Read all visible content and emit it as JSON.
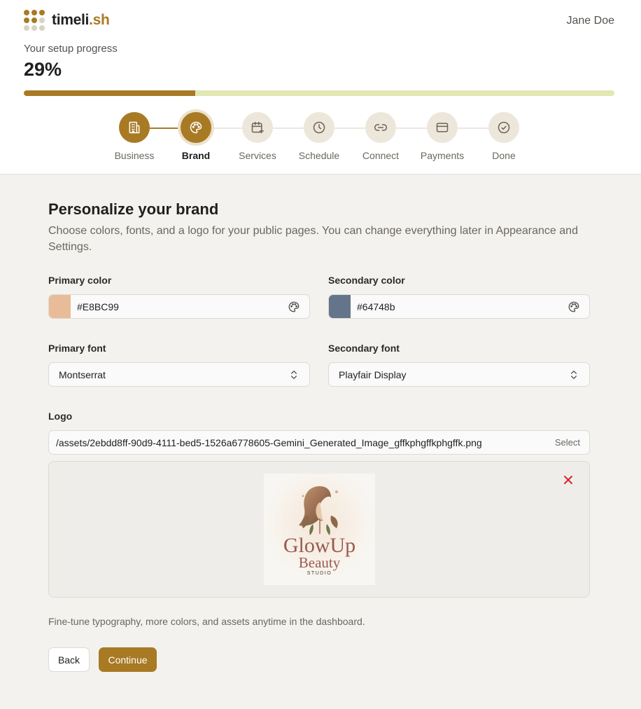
{
  "app": {
    "logo_text": "timeli",
    "logo_accent": ".sh",
    "user_name": "Jane Doe",
    "brand_color": "#a87a24"
  },
  "progress": {
    "label": "Your setup progress",
    "value_text": "29%",
    "fraction": 0.29
  },
  "steps": [
    {
      "label": "Business",
      "status": "done",
      "icon": "building-icon"
    },
    {
      "label": "Brand",
      "status": "current",
      "icon": "palette-icon"
    },
    {
      "label": "Services",
      "status": "pending",
      "icon": "calendar-plus-icon"
    },
    {
      "label": "Schedule",
      "status": "pending",
      "icon": "clock-icon"
    },
    {
      "label": "Connect",
      "status": "pending",
      "icon": "link-icon"
    },
    {
      "label": "Payments",
      "status": "pending",
      "icon": "credit-card-icon"
    },
    {
      "label": "Done",
      "status": "pending",
      "icon": "check-circle-icon"
    }
  ],
  "page": {
    "title": "Personalize your brand",
    "subtitle": "Choose colors, fonts, and a logo for your public pages. You can change everything later in Appearance and Settings."
  },
  "form": {
    "primary_color": {
      "label": "Primary color",
      "value": "#E8BC99",
      "swatch": "#E8BC99"
    },
    "secondary_color": {
      "label": "Secondary color",
      "value": "#64748b",
      "swatch": "#64748b"
    },
    "primary_font": {
      "label": "Primary font",
      "value": "Montserrat"
    },
    "secondary_font": {
      "label": "Secondary font",
      "value": "Playfair Display"
    },
    "logo": {
      "label": "Logo",
      "path": "/assets/2ebdd8ff-90d9-4111-bed5-1526a6778605-Gemini_Generated_Image_gffkphgffkphgffk.png",
      "select_label": "Select",
      "preview_text_line1": "GlowUp",
      "preview_text_line2": "Beauty",
      "preview_text_line3": "STUDIO"
    }
  },
  "footer": {
    "hint": "Fine-tune typography, more colors, and assets anytime in the dashboard.",
    "back_label": "Back",
    "continue_label": "Continue"
  }
}
